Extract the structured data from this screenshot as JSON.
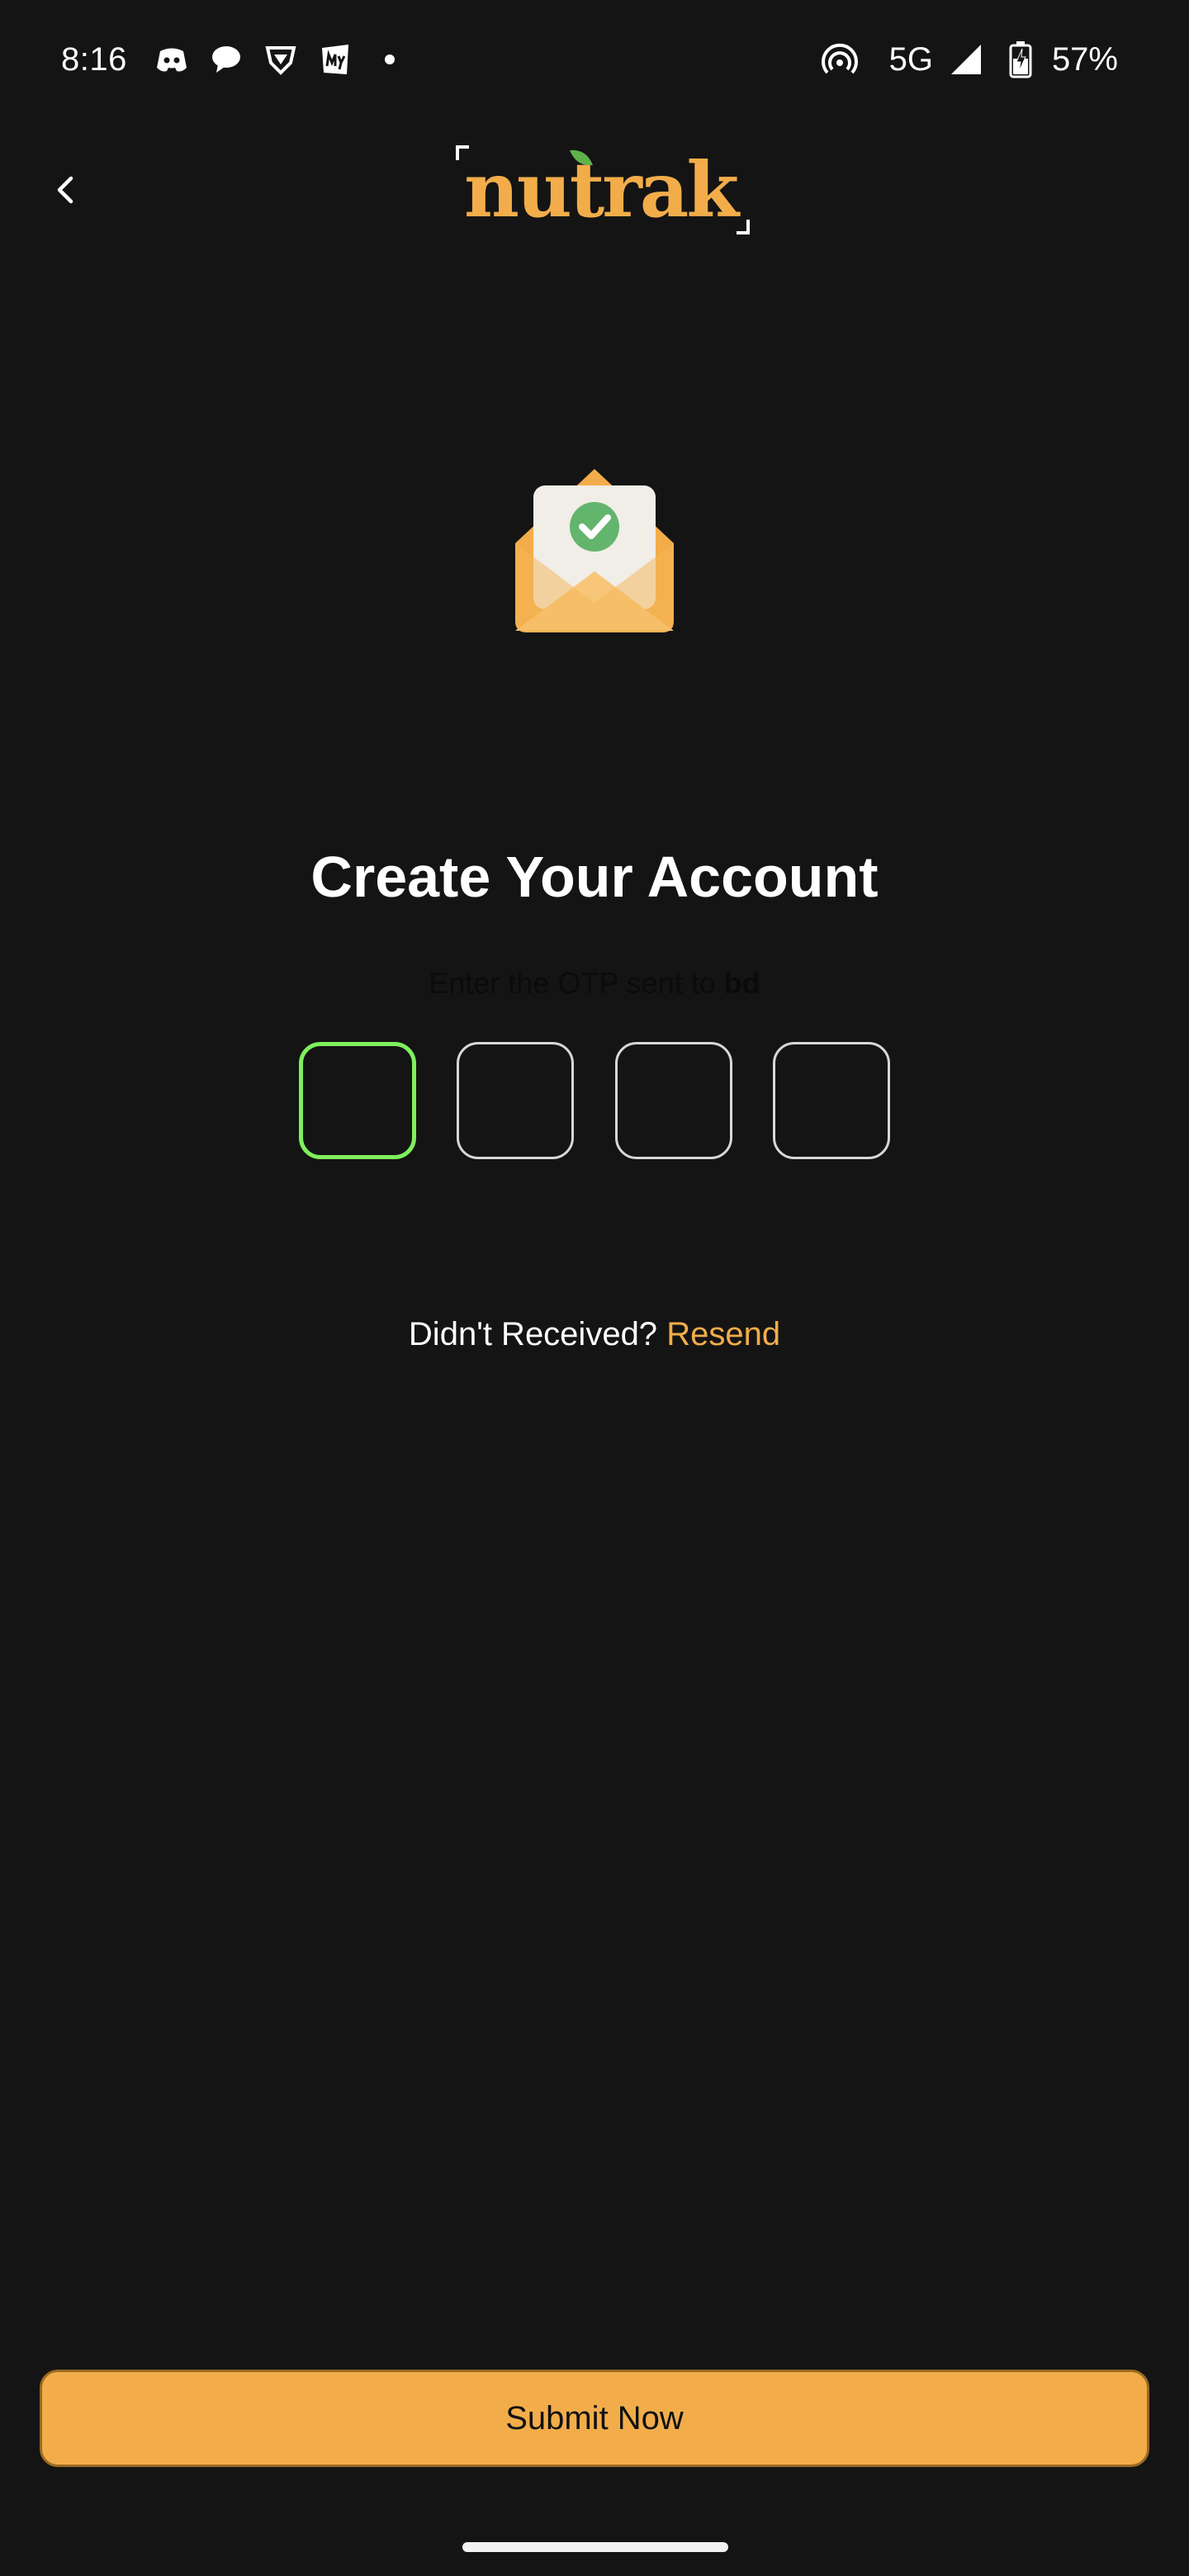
{
  "status_bar": {
    "time": "8:16",
    "network": "5G",
    "battery": "57%",
    "icons": [
      "discord-icon",
      "chat-icon",
      "brave-icon",
      "myntra-icon",
      "hotspot-icon",
      "signal-icon",
      "battery-charging-icon"
    ]
  },
  "header": {
    "back_icon": "chevron-left-icon",
    "logo_text": "nutrak"
  },
  "illustration": "envelope-check-icon",
  "main": {
    "title": "Create Your Account",
    "subtitle_prefix": "Enter the OTP sent to ",
    "subtitle_target": "bd",
    "otp_boxes": [
      "",
      "",
      "",
      ""
    ],
    "resend_prefix": "Didn't Received?",
    "resend_link": "Resend"
  },
  "footer": {
    "submit_label": "Submit Now"
  },
  "colors": {
    "background": "#141414",
    "accent": "#f2ad4a",
    "active_otp_border": "#7ef05c",
    "otp_border": "#d7d7d7"
  }
}
